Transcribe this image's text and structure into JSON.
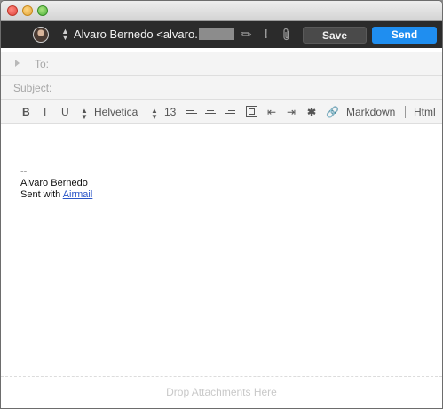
{
  "toolbar": {
    "sender_name": "Alvaro Bernedo <alvaro.",
    "save_label": "Save",
    "send_label": "Send"
  },
  "fields": {
    "to_label": "To:",
    "subject_label": "Subject:"
  },
  "format_bar": {
    "bold": "B",
    "italic": "I",
    "underline": "U",
    "font_name": "Helvetica",
    "font_size": "13",
    "markdown": "Markdown",
    "html": "Html"
  },
  "body": {
    "separator": "--",
    "name": "Alvaro Bernedo",
    "sent_with": "Sent with",
    "airmail_link": "Airmail"
  },
  "drop_zone": {
    "text": "Drop Attachments Here"
  },
  "colors": {
    "toolbar_bg": "#2b2b2b",
    "send_button": "#1f8ef0",
    "link": "#2a55c8"
  }
}
